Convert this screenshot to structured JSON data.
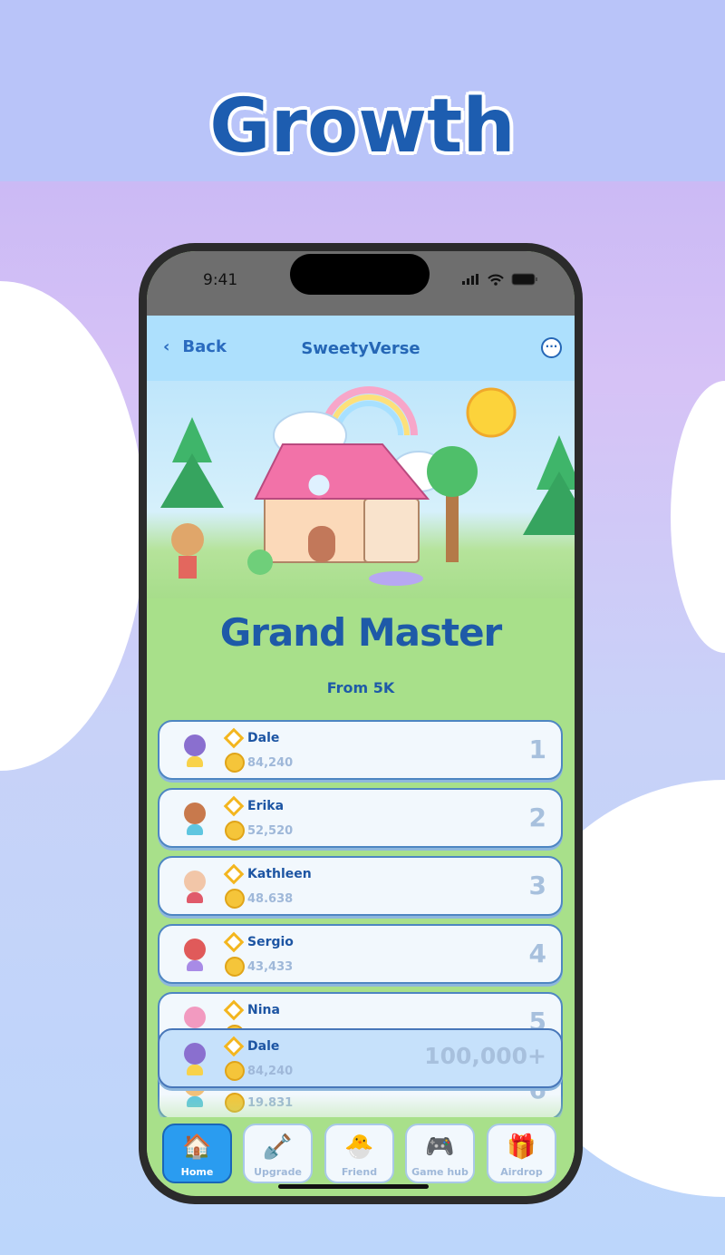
{
  "headline": "Growth",
  "status_bar": {
    "time": "9:41"
  },
  "nav": {
    "back_label": "Back",
    "title": "SweetyVerse",
    "more_icon": "ellipsis-circle-icon"
  },
  "hero": {
    "title": "Grand Master",
    "subtitle": "From 5K"
  },
  "leaderboard": [
    {
      "name": "Dale",
      "score": "84,240",
      "rank": "1",
      "avatar_color": "#8a6fcf",
      "shirt": "#f8d24a"
    },
    {
      "name": "Erika",
      "score": "52,520",
      "rank": "2",
      "avatar_color": "#c8794c",
      "shirt": "#5fc6e0"
    },
    {
      "name": "Kathleen",
      "score": "48.638",
      "rank": "3",
      "avatar_color": "#f2c6a8",
      "shirt": "#e05a6a"
    },
    {
      "name": "Sergio",
      "score": "43,433",
      "rank": "4",
      "avatar_color": "#e05a5a",
      "shirt": "#a88be6"
    },
    {
      "name": "Nina",
      "score": "",
      "rank": "5",
      "avatar_color": "#f29ac0",
      "shirt": "#f29ac0"
    },
    {
      "name": "",
      "score": "19.831",
      "rank": "6",
      "avatar_color": "#f0c07a",
      "shirt": "#5fc6e0"
    }
  ],
  "current_user": {
    "name": "Dale",
    "score": "84,240",
    "rank": "100,000+",
    "avatar_color": "#8a6fcf",
    "shirt": "#f8d24a"
  },
  "tabs": [
    {
      "label": "Home",
      "icon": "house-icon",
      "active": true
    },
    {
      "label": "Upgrade",
      "icon": "shovel-icon"
    },
    {
      "label": "Friend",
      "icon": "friend-add-icon"
    },
    {
      "label": "Game hub",
      "icon": "gameboy-icon"
    },
    {
      "label": "Airdrop",
      "icon": "gift-icon"
    }
  ],
  "colors": {
    "accent": "#1e5aa8",
    "active_tab": "#2a9cf0",
    "coin": "#f5c53a",
    "gem": "#f3b61f"
  }
}
